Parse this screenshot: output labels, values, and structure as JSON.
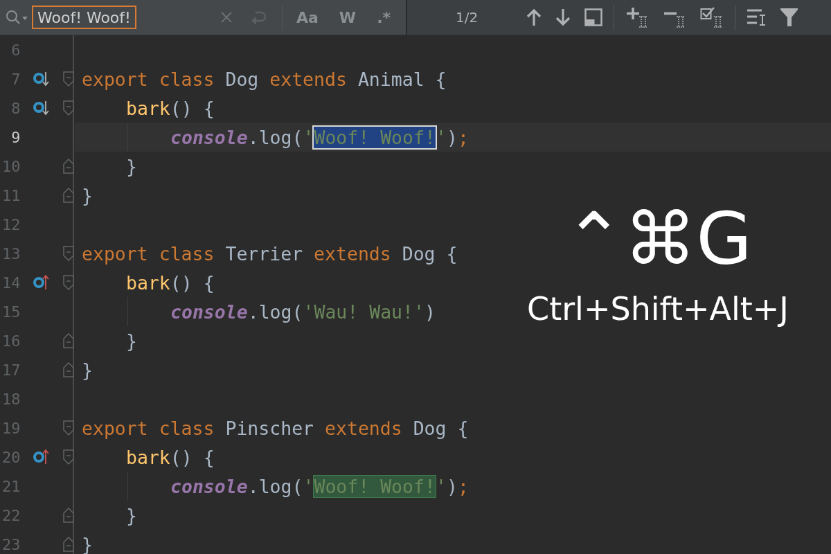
{
  "search_bar": {
    "value": "Woof! Woof!",
    "toggles": [
      {
        "label": "Aa",
        "on": false
      },
      {
        "label": "W",
        "on": false
      },
      {
        "label": ".*",
        "on": false
      }
    ],
    "match_count": "1/2"
  },
  "lines": [
    {
      "number": "6",
      "current": false
    },
    {
      "number": "7",
      "current": false,
      "gutter_icons": [
        {
          "kind": "implemented"
        },
        {
          "kind": "fold_start"
        }
      ],
      "tokens": [
        {
          "text": "export class ",
          "kind": "keyword"
        },
        {
          "text": "Dog ",
          "kind": "plain"
        },
        {
          "text": "extends ",
          "kind": "keyword"
        },
        {
          "text": "Animal {",
          "kind": "plain"
        }
      ],
      "children": [
        {
          "number": "8",
          "current": false,
          "gutter_icons": [
            {
              "kind": "implemented"
            },
            {
              "kind": "fold_start"
            }
          ],
          "tokens": [
            {
              "text": "bark",
              "kind": "method"
            },
            {
              "text": "() {",
              "kind": "plain"
            }
          ],
          "children": [
            {
              "number": "9",
              "current": true,
              "tokens": [
                {
                  "text": "console",
                  "kind": "object"
                },
                {
                  "text": ".log(",
                  "kind": "plain"
                },
                {
                  "text": "'",
                  "kind": "string"
                },
                {
                  "text": "Woof! Woof!",
                  "kind": "match",
                  "selected": true
                },
                {
                  "text": "'",
                  "kind": "string"
                },
                {
                  "text": ")",
                  "kind": "plain"
                },
                {
                  "text": ";",
                  "kind": "keyword"
                }
              ]
            }
          ]
        },
        {
          "number": "10",
          "current": false,
          "gutter_icons": [
            {
              "kind": "fold_end"
            }
          ],
          "tokens": [
            {
              "text": "}",
              "kind": "plain"
            }
          ]
        }
      ]
    },
    {
      "number": "11",
      "current": false,
      "gutter_icons": [
        {
          "kind": "fold_end"
        }
      ],
      "tokens": [
        {
          "text": "}",
          "kind": "plain"
        }
      ]
    },
    {
      "number": "12",
      "current": false
    },
    {
      "number": "13",
      "current": false,
      "gutter_icons": [
        {
          "kind": "fold_start"
        }
      ],
      "tokens": [
        {
          "text": "export class ",
          "kind": "keyword"
        },
        {
          "text": "Terrier ",
          "kind": "plain"
        },
        {
          "text": "extends ",
          "kind": "keyword"
        },
        {
          "text": "Dog {",
          "kind": "plain"
        }
      ],
      "children": [
        {
          "number": "14",
          "current": false,
          "gutter_icons": [
            {
              "kind": "overrides"
            },
            {
              "kind": "fold_start"
            }
          ],
          "tokens": [
            {
              "text": "bark",
              "kind": "method"
            },
            {
              "text": "() {",
              "kind": "plain"
            }
          ],
          "children": [
            {
              "number": "15",
              "current": false,
              "tokens": [
                {
                  "text": "console",
                  "kind": "object"
                },
                {
                  "text": ".log(",
                  "kind": "plain"
                },
                {
                  "text": "'Wau! Wau!'",
                  "kind": "string"
                },
                {
                  "text": ")",
                  "kind": "plain"
                }
              ]
            }
          ]
        },
        {
          "number": "16",
          "current": false,
          "gutter_icons": [
            {
              "kind": "fold_end"
            }
          ],
          "tokens": [
            {
              "text": "}",
              "kind": "plain"
            }
          ]
        }
      ]
    },
    {
      "number": "17",
      "current": false,
      "gutter_icons": [
        {
          "kind": "fold_end"
        }
      ],
      "tokens": [
        {
          "text": "}",
          "kind": "plain"
        }
      ]
    },
    {
      "number": "18",
      "current": false
    },
    {
      "number": "19",
      "current": false,
      "gutter_icons": [
        {
          "kind": "fold_start"
        }
      ],
      "tokens": [
        {
          "text": "export class ",
          "kind": "keyword"
        },
        {
          "text": "Pinscher ",
          "kind": "plain"
        },
        {
          "text": "extends ",
          "kind": "keyword"
        },
        {
          "text": "Dog {",
          "kind": "plain"
        }
      ],
      "children": [
        {
          "number": "20",
          "current": false,
          "gutter_icons": [
            {
              "kind": "overrides"
            },
            {
              "kind": "fold_start"
            }
          ],
          "tokens": [
            {
              "text": "bark",
              "kind": "method"
            },
            {
              "text": "() {",
              "kind": "plain"
            }
          ],
          "children": [
            {
              "number": "21",
              "current": false,
              "tokens": [
                {
                  "text": "console",
                  "kind": "object"
                },
                {
                  "text": ".log(",
                  "kind": "plain"
                },
                {
                  "text": "'",
                  "kind": "string"
                },
                {
                  "text": "Woof! Woof!",
                  "kind": "match",
                  "selected": false
                },
                {
                  "text": "'",
                  "kind": "string"
                },
                {
                  "text": ")",
                  "kind": "plain"
                },
                {
                  "text": ";",
                  "kind": "keyword"
                }
              ]
            }
          ]
        },
        {
          "number": "22",
          "current": false,
          "gutter_icons": [
            {
              "kind": "fold_end"
            }
          ],
          "tokens": [
            {
              "text": "}",
              "kind": "plain"
            }
          ]
        }
      ]
    },
    {
      "number": "23",
      "current": false,
      "gutter_icons": [
        {
          "kind": "fold_end"
        }
      ],
      "tokens": [
        {
          "text": "}",
          "kind": "plain"
        }
      ]
    }
  ],
  "shortcut_overlay": {
    "mac": "⌃⌘G",
    "windows": "Ctrl+Shift+Alt+J"
  }
}
